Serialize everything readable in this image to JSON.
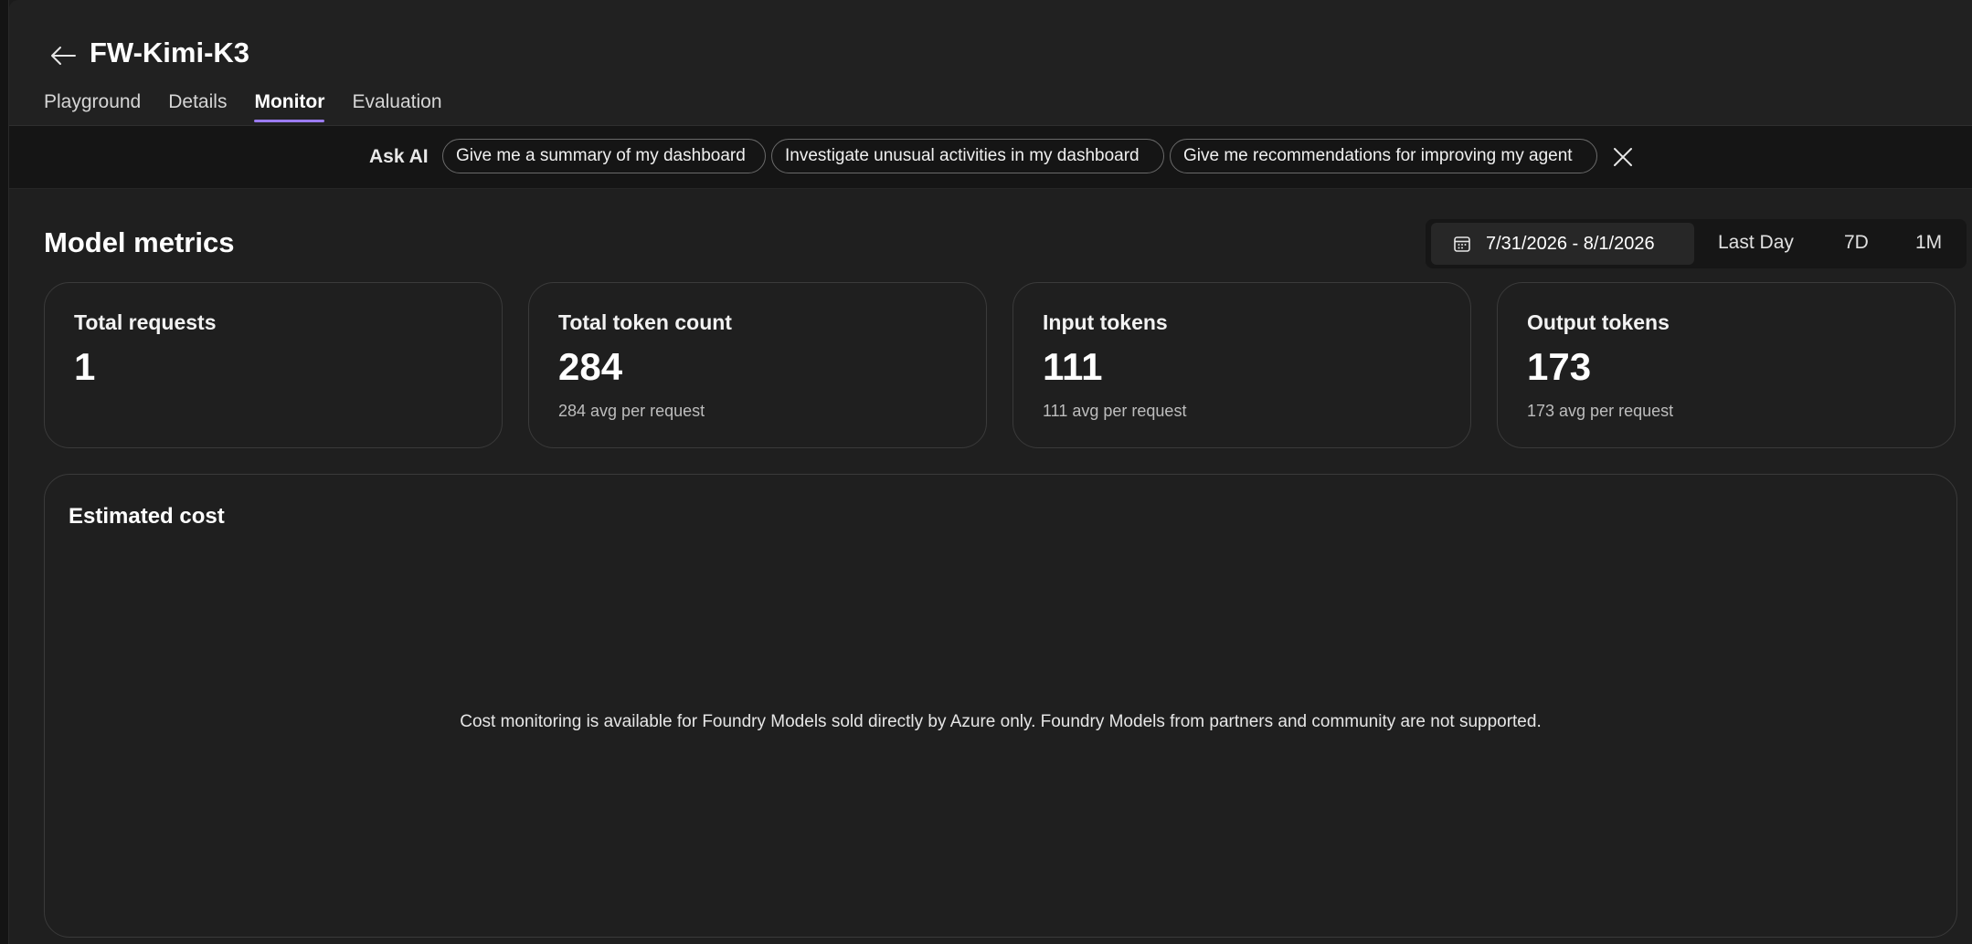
{
  "header": {
    "title": "FW-Kimi-K3",
    "back_icon": "arrow-left-icon",
    "tabs": [
      {
        "label": "Playground",
        "active": false
      },
      {
        "label": "Details",
        "active": false
      },
      {
        "label": "Monitor",
        "active": true
      },
      {
        "label": "Evaluation",
        "active": false
      }
    ],
    "active_tab_color": "#9b7bf0"
  },
  "ask_ai": {
    "label": "Ask AI",
    "suggestions": [
      "Give me a summary of my dashboard",
      "Investigate unusual activities in my dashboard",
      "Give me recommendations for improving my agent"
    ],
    "close_icon": "close-icon"
  },
  "metrics": {
    "title": "Model metrics",
    "date_range": "7/31/2026 - 8/1/2026",
    "calendar_icon": "calendar-icon",
    "range_options": [
      "Last Day",
      "7D",
      "1M"
    ],
    "cards": [
      {
        "label": "Total requests",
        "value": "1",
        "sub": ""
      },
      {
        "label": "Total token count",
        "value": "284",
        "sub": "284 avg per request"
      },
      {
        "label": "Input tokens",
        "value": "111",
        "sub": "111 avg per request"
      },
      {
        "label": "Output tokens",
        "value": "173",
        "sub": "173 avg per request"
      }
    ]
  },
  "cost": {
    "title": "Estimated cost",
    "message": "Cost monitoring is available for Foundry Models sold directly by Azure only. Foundry Models from partners and community are not supported."
  }
}
